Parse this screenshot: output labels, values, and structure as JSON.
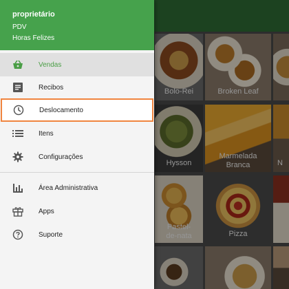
{
  "header": {
    "owner": "proprietário",
    "pdv": "PDV",
    "store": "Horas Felizes"
  },
  "menu": {
    "sales": "Vendas",
    "receipts": "Recibos",
    "shift": "Deslocamento",
    "items": "Itens",
    "settings": "Configurações",
    "admin": "Área Administrativa",
    "apps": "Apps",
    "support": "Suporte"
  },
  "tiles": {
    "bolo_rei": "Bolo-Rei",
    "broken_leaf": "Broken Leaf",
    "hysson": "Hysson",
    "marmelada_1": "Marmelada",
    "marmelada_2": "Branca",
    "n_partial": "N",
    "pastel_1": "Pastel-",
    "pastel_2": "de-nata",
    "pizza": "Pizza"
  },
  "colors": {
    "header_green": "#46a24c",
    "active_text": "#4a9e46",
    "highlight_border": "#f0843e"
  }
}
